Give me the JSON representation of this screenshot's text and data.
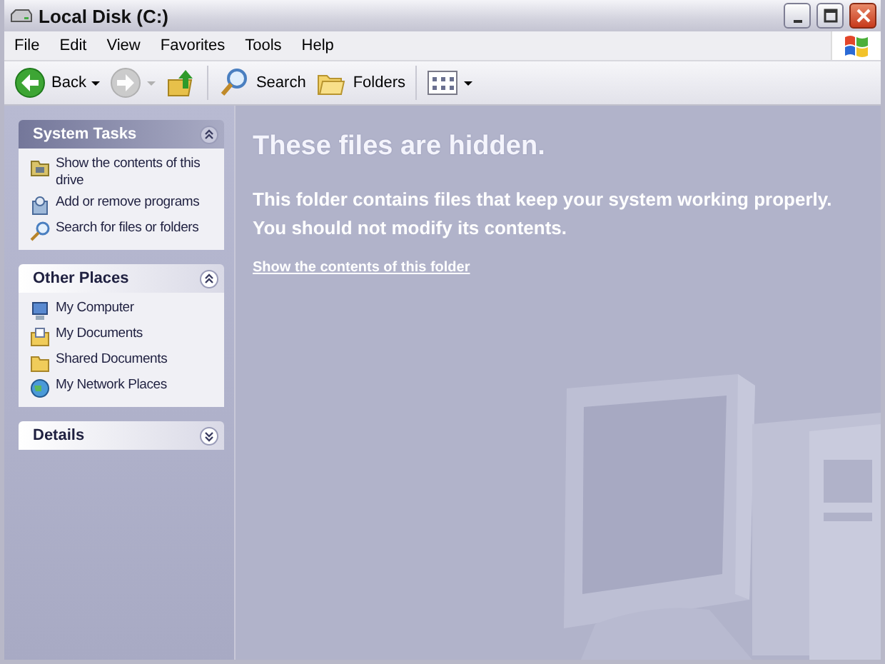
{
  "window": {
    "title": "Local Disk (C:)"
  },
  "menu": [
    "File",
    "Edit",
    "View",
    "Favorites",
    "Tools",
    "Help"
  ],
  "toolbar": [
    {
      "kind": "back",
      "label": "Back",
      "disabled": false
    },
    {
      "kind": "forward",
      "disabled": true
    },
    {
      "kind": "up",
      "disabled": false
    },
    {
      "kind": "search",
      "label": "Search",
      "disabled": false
    },
    {
      "kind": "folders",
      "label": "Folders",
      "disabled": false
    },
    {
      "kind": "views",
      "disabled": false
    }
  ],
  "panels": [
    {
      "title": "System Tasks",
      "kind": "special",
      "expanded": true,
      "items": [
        {
          "kind": "drive",
          "label": "Show the contents of this drive"
        },
        {
          "kind": "programs",
          "label": "Add or remove programs"
        },
        {
          "kind": "search",
          "label": "Search for files or folders"
        }
      ]
    },
    {
      "title": "Other Places",
      "kind": "plain",
      "expanded": true,
      "items": [
        {
          "kind": "computer",
          "label": "My Computer"
        },
        {
          "kind": "documents",
          "label": "My Documents"
        },
        {
          "kind": "folder",
          "label": "Shared Documents"
        },
        {
          "kind": "network",
          "label": "My Network Places"
        }
      ]
    },
    {
      "title": "Details",
      "kind": "plain",
      "expanded": false
    }
  ],
  "message": {
    "title": "These files are hidden.",
    "lines": [
      "This folder contains files that keep your system working properly.",
      "You should not modify its contents."
    ],
    "link": "Show the contents of this folder"
  }
}
